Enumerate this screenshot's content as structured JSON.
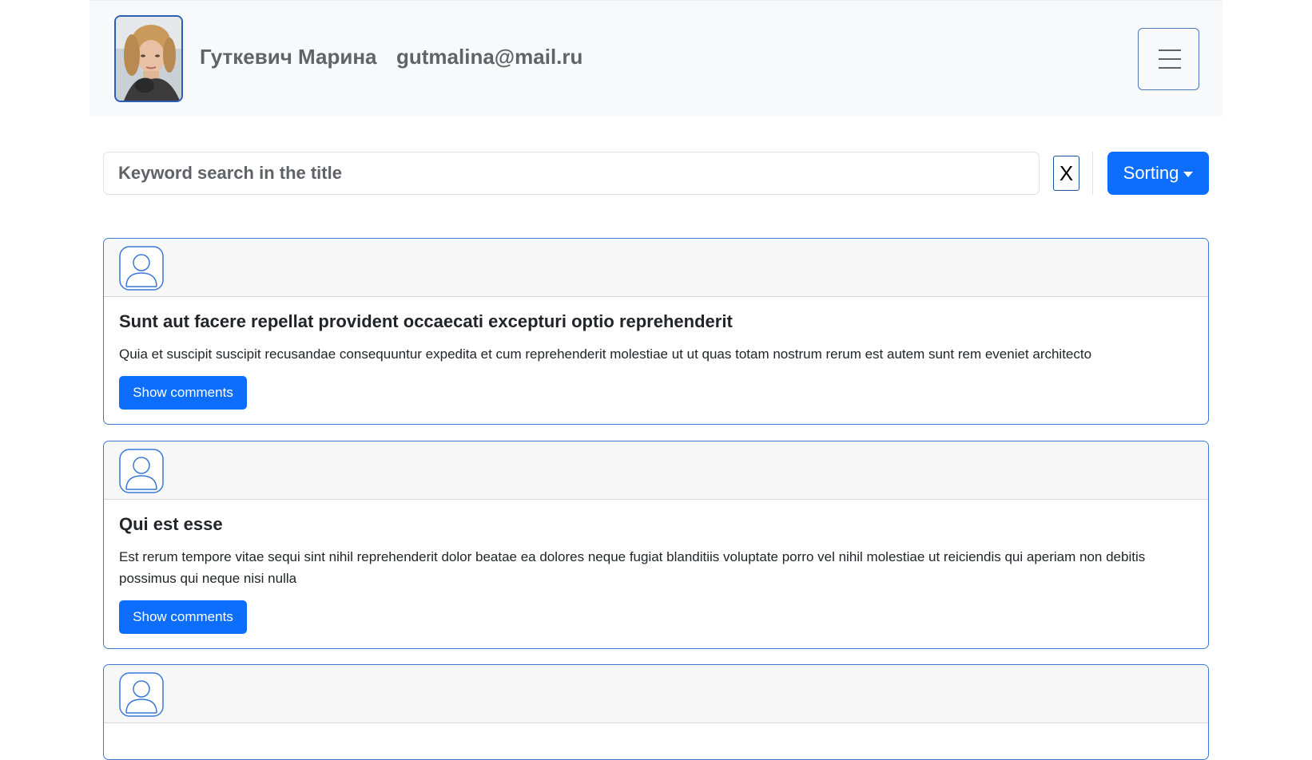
{
  "header": {
    "user_name": "Гуткевич Марина",
    "user_email": "gutmalina@mail.ru",
    "avatar_icon": "user-photo",
    "menu_icon": "hamburger-menu-icon"
  },
  "search": {
    "placeholder": "Keyword search in the title",
    "value": "",
    "clear_label": "X"
  },
  "sorting": {
    "label": "Sorting"
  },
  "colors": {
    "primary": "#0d6efd",
    "card_border": "#3b78d6",
    "navbar_bg": "#f8f9fa"
  },
  "posts": [
    {
      "title": "Sunt aut facere repellat provident occaecati excepturi optio reprehenderit",
      "body": "Quia et suscipit suscipit recusandae consequuntur expedita et cum reprehenderit molestiae ut ut quas totam nostrum rerum est autem sunt rem eveniet architecto",
      "button_label": "Show comments"
    },
    {
      "title": "Qui est esse",
      "body": "Est rerum tempore vitae sequi sint nihil reprehenderit dolor beatae ea dolores neque fugiat blanditiis voluptate porro vel nihil molestiae ut reiciendis qui aperiam non debitis possimus qui neque nisi nulla",
      "button_label": "Show comments"
    },
    {
      "title": "",
      "body": "",
      "button_label": ""
    }
  ]
}
